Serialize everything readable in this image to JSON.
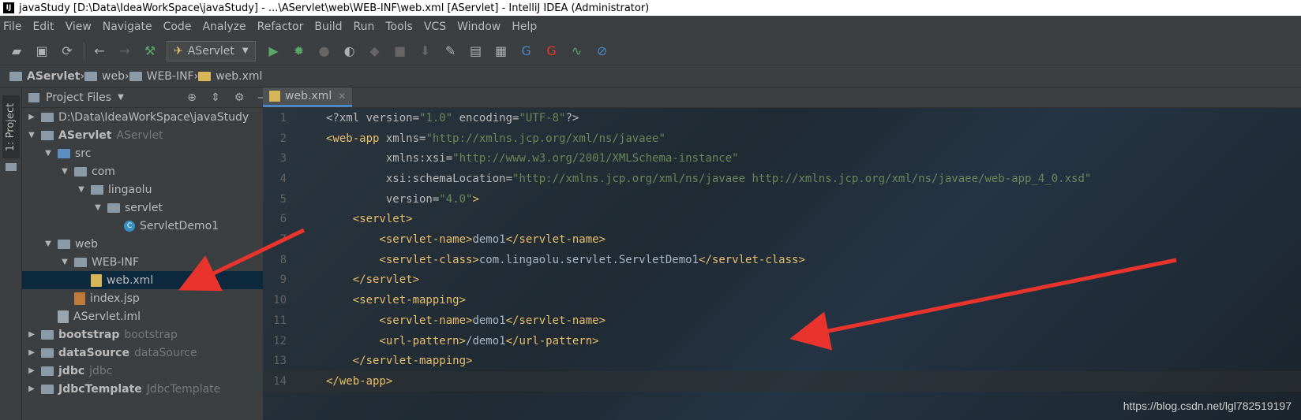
{
  "window": {
    "title": "javaStudy [D:\\Data\\IdeaWorkSpace\\javaStudy] - ...\\AServlet\\web\\WEB-INF\\web.xml [AServlet] - IntelliJ IDEA (Administrator)",
    "app_icon_text": "IJ"
  },
  "menu": [
    "File",
    "Edit",
    "View",
    "Navigate",
    "Code",
    "Analyze",
    "Refactor",
    "Build",
    "Run",
    "Tools",
    "VCS",
    "Window",
    "Help"
  ],
  "toolbar": {
    "run_config": "AServlet"
  },
  "breadcrumbs": [
    "AServlet",
    "web",
    "WEB-INF",
    "web.xml"
  ],
  "side_tab": "1: Project",
  "project": {
    "header": "Project Files",
    "tree": [
      {
        "indent": 0,
        "arrow": "▶",
        "icon": "folder",
        "label": "D:\\Data\\IdeaWorkSpace\\javaStudy",
        "sub": "",
        "bold": false
      },
      {
        "indent": 0,
        "arrow": "▼",
        "icon": "module",
        "label": "AServlet",
        "sub": "AServlet",
        "bold": true
      },
      {
        "indent": 1,
        "arrow": "▼",
        "icon": "src-folder",
        "label": "src",
        "sub": "",
        "bold": false
      },
      {
        "indent": 2,
        "arrow": "▼",
        "icon": "pkg",
        "label": "com",
        "sub": "",
        "bold": false
      },
      {
        "indent": 3,
        "arrow": "▼",
        "icon": "pkg",
        "label": "lingaolu",
        "sub": "",
        "bold": false
      },
      {
        "indent": 4,
        "arrow": "▼",
        "icon": "pkg",
        "label": "servlet",
        "sub": "",
        "bold": false
      },
      {
        "indent": 5,
        "arrow": "",
        "icon": "class",
        "label": "ServletDemo1",
        "sub": "",
        "bold": false
      },
      {
        "indent": 1,
        "arrow": "▼",
        "icon": "web-folder",
        "label": "web",
        "sub": "",
        "bold": false
      },
      {
        "indent": 2,
        "arrow": "▼",
        "icon": "folder",
        "label": "WEB-INF",
        "sub": "",
        "bold": false
      },
      {
        "indent": 3,
        "arrow": "",
        "icon": "xml",
        "label": "web.xml",
        "sub": "",
        "bold": false,
        "selected": true
      },
      {
        "indent": 2,
        "arrow": "",
        "icon": "jsp",
        "label": "index.jsp",
        "sub": "",
        "bold": false
      },
      {
        "indent": 1,
        "arrow": "",
        "icon": "iml",
        "label": "AServlet.iml",
        "sub": "",
        "bold": false
      },
      {
        "indent": 0,
        "arrow": "▶",
        "icon": "module",
        "label": "bootstrap",
        "sub": "bootstrap",
        "bold": true
      },
      {
        "indent": 0,
        "arrow": "▶",
        "icon": "module",
        "label": "dataSource",
        "sub": "dataSource",
        "bold": true
      },
      {
        "indent": 0,
        "arrow": "▶",
        "icon": "module",
        "label": "jdbc",
        "sub": "jdbc",
        "bold": true
      },
      {
        "indent": 0,
        "arrow": "▶",
        "icon": "module",
        "label": "JdbcTemplate",
        "sub": "JdbcTemplate",
        "bold": true
      }
    ]
  },
  "editor": {
    "tab": "web.xml",
    "current_line": 14,
    "lines": [
      {
        "n": "1",
        "parts": [
          [
            "pi",
            "<?xml version="
          ],
          [
            "val",
            "\"1.0\""
          ],
          [
            "pi",
            " encoding="
          ],
          [
            "val",
            "\"UTF-8\""
          ],
          [
            "pi",
            "?>"
          ]
        ]
      },
      {
        "n": "2",
        "parts": [
          [
            "tag",
            "<web-app"
          ],
          [
            "attr",
            " xmlns="
          ],
          [
            "val",
            "\"http://xmlns.jcp.org/xml/ns/javaee\""
          ]
        ]
      },
      {
        "n": "3",
        "parts": [
          [
            "attr",
            "         xmlns:xsi="
          ],
          [
            "val",
            "\"http://www.w3.org/2001/XMLSchema-instance\""
          ]
        ]
      },
      {
        "n": "4",
        "parts": [
          [
            "attr",
            "         xsi:schemaLocation="
          ],
          [
            "val",
            "\"http://xmlns.jcp.org/xml/ns/javaee http://xmlns.jcp.org/xml/ns/javaee/web-app_4_0.xsd\""
          ]
        ]
      },
      {
        "n": "5",
        "parts": [
          [
            "attr",
            "         version="
          ],
          [
            "val",
            "\"4.0\""
          ],
          [
            "tag",
            ">"
          ]
        ]
      },
      {
        "n": "6",
        "parts": [
          [
            "tag",
            "    <servlet>"
          ]
        ]
      },
      {
        "n": "7",
        "parts": [
          [
            "tag",
            "        <servlet-name>"
          ],
          [
            "txt",
            "demo1"
          ],
          [
            "tag",
            "</servlet-name>"
          ]
        ]
      },
      {
        "n": "8",
        "parts": [
          [
            "tag",
            "        <servlet-class>"
          ],
          [
            "txt",
            "com.lingaolu.servlet.ServletDemo1"
          ],
          [
            "tag",
            "</servlet-class>"
          ]
        ]
      },
      {
        "n": "9",
        "parts": [
          [
            "tag",
            "    </servlet>"
          ]
        ]
      },
      {
        "n": "10",
        "parts": [
          [
            "tag",
            "    <servlet-mapping>"
          ]
        ]
      },
      {
        "n": "11",
        "parts": [
          [
            "tag",
            "        <servlet-name>"
          ],
          [
            "txt",
            "demo1"
          ],
          [
            "tag",
            "</servlet-name>"
          ]
        ]
      },
      {
        "n": "12",
        "parts": [
          [
            "tag",
            "        <url-pattern>"
          ],
          [
            "txt",
            "/demo1"
          ],
          [
            "tag",
            "</url-pattern>"
          ]
        ]
      },
      {
        "n": "13",
        "parts": [
          [
            "tag",
            "    </servlet-mapping>"
          ]
        ]
      },
      {
        "n": "14",
        "parts": [
          [
            "tag",
            "</web-app>"
          ]
        ]
      }
    ]
  },
  "watermark": "https://blog.csdn.net/lgl782519197",
  "colors": {
    "arrow": "#e8342c",
    "tag": "#e8bf6a",
    "value": "#6a8759",
    "selection": "#0d293e"
  }
}
